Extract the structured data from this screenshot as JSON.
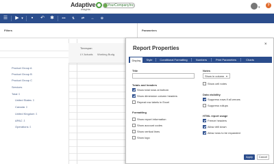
{
  "header": {
    "logo_main": "Adaptive",
    "logo_sub": "Insights",
    "company": "YourCompanyInc.",
    "help": "?"
  },
  "toolbar": {
    "icons": [
      "menu-icon",
      "play-icon",
      "save-icon",
      "undo-icon",
      "settings-icon",
      "more-icon"
    ]
  },
  "filters": {
    "filters_label": "Filters",
    "parameters_label": "Parameters"
  },
  "grid": {
    "timespan_label": "Timespan",
    "col1": "LY Actuals",
    "col2": "Working Budg",
    "rows": [
      "Product Group A",
      "Product Group B",
      "Product Group C",
      "Services",
      "Total",
      "United States",
      "Canada",
      "United Kingdom",
      "APAC",
      "Operations"
    ]
  },
  "dialog": {
    "title": "Report Properties",
    "close": "×",
    "tabs": [
      "Display",
      "Style",
      "Conditional Formatting",
      "Numbers",
      "Print Parameters",
      "Charts"
    ],
    "active_tab": "Display",
    "title_label": "Title",
    "totals_heading": "Totals and headers",
    "totals": [
      {
        "label": "Show total rows at bottom",
        "checked": true
      },
      {
        "label": "Show dimension column headers",
        "checked": true
      },
      {
        "label": "Repeat row labels in Excel",
        "checked": false
      }
    ],
    "formatting_heading": "Formatting",
    "formatting": [
      {
        "label": "Show report information",
        "checked": false
      },
      {
        "label": "Show account codes",
        "checked": false
      },
      {
        "label": "Show vertical lines",
        "checked": false
      },
      {
        "label": "Show logo",
        "checked": false
      }
    ],
    "notes_label": "Notes",
    "notes_value": "Show in column",
    "cell_notes": {
      "label": "Show cell notes",
      "checked": false
    },
    "visibility_heading": "Data visibility",
    "visibility": [
      {
        "label": "Suppress rows if all zeroes",
        "checked": true
      },
      {
        "label": "Suppress rollups",
        "checked": false
      }
    ],
    "html_heading": "HTML report usage",
    "html": [
      {
        "label": "Freeze headers",
        "checked": true
      },
      {
        "label": "Allow drill down",
        "checked": true
      },
      {
        "label": "Allow rows to be expanded",
        "checked": true
      }
    ],
    "apply": "Apply",
    "cancel": "Cancel"
  }
}
